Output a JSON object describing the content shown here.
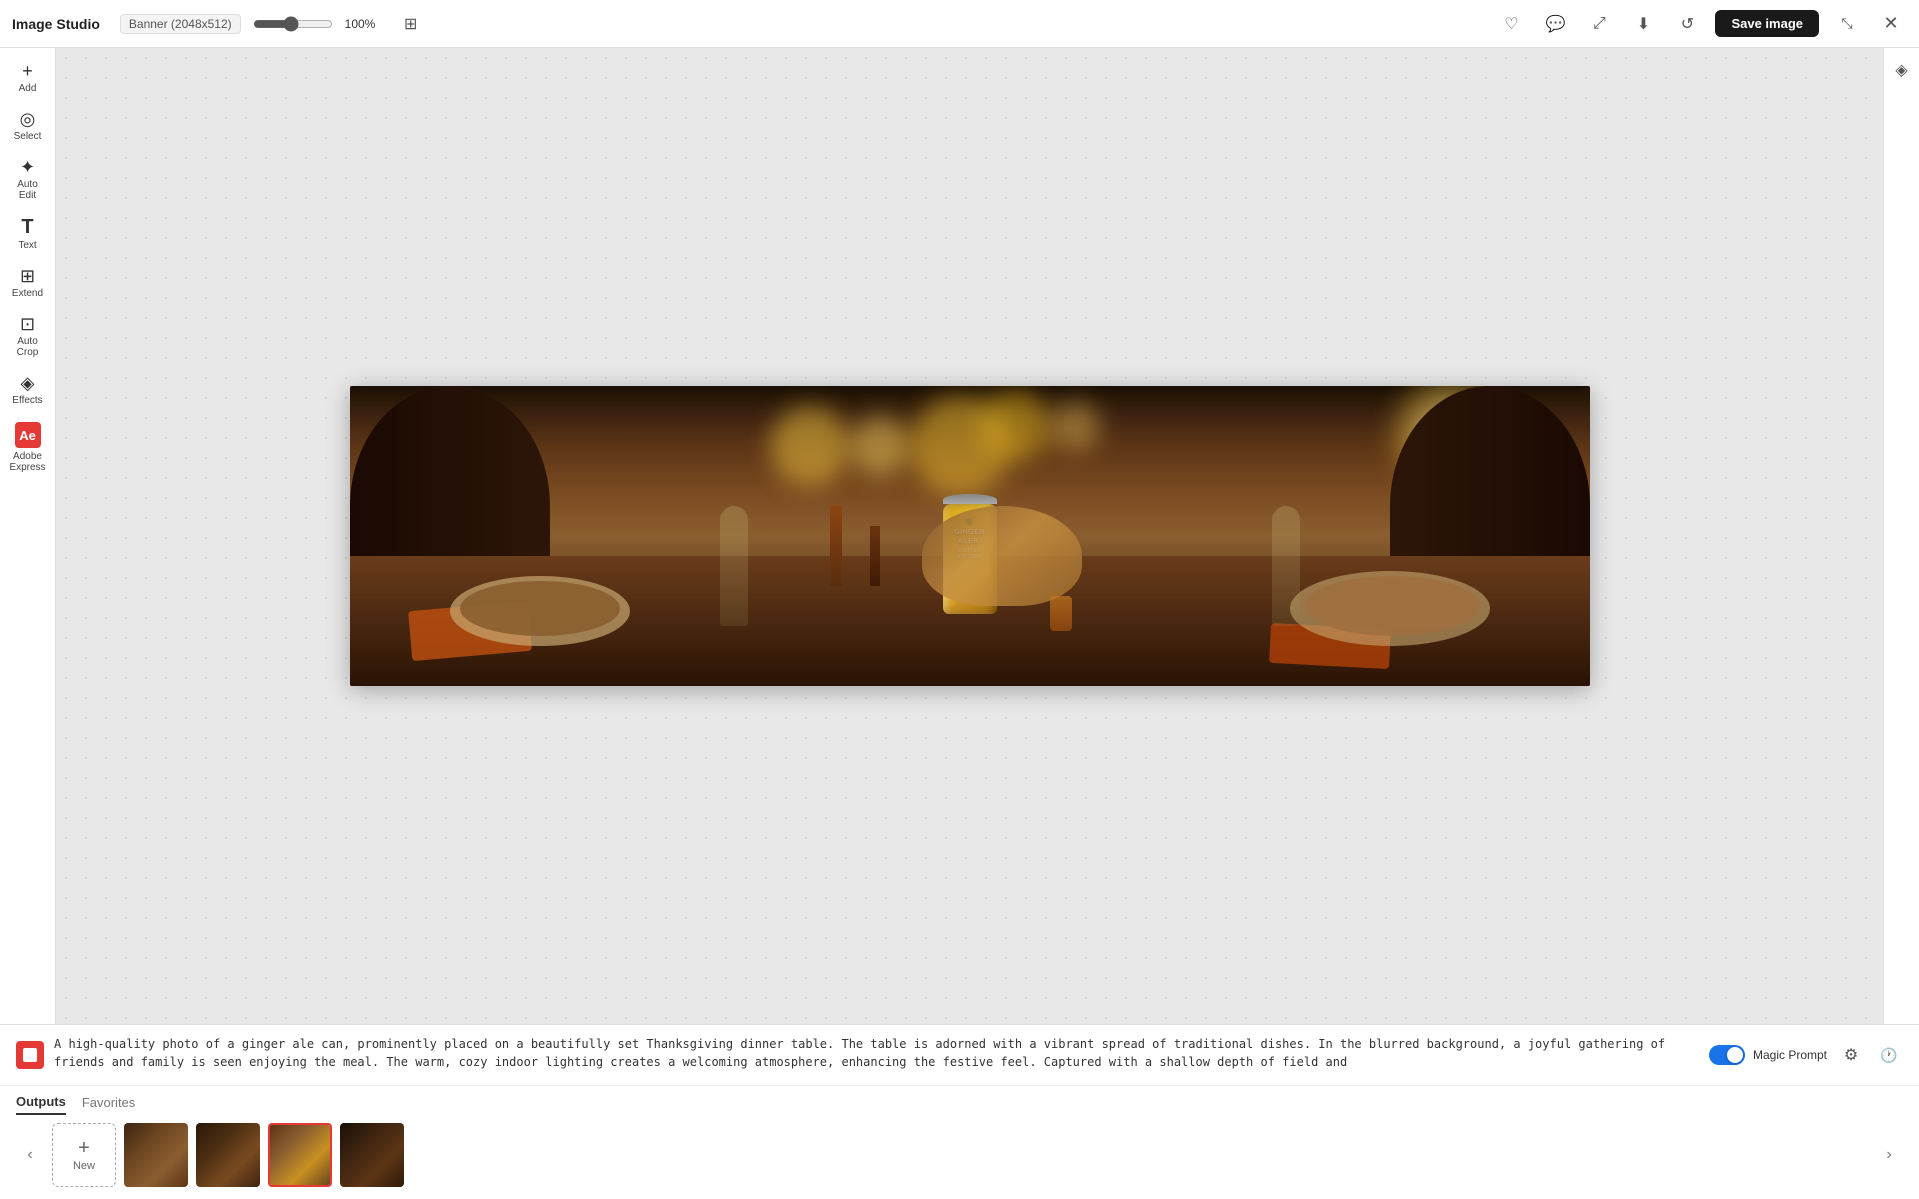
{
  "app": {
    "title": "Image Studio"
  },
  "topbar": {
    "canvas_size": "Banner (2048x512)",
    "zoom_value": 100,
    "zoom_label": "100%",
    "save_label": "Save image"
  },
  "sidebar": {
    "tools": [
      {
        "id": "add",
        "icon": "+",
        "label": "Add"
      },
      {
        "id": "select",
        "icon": "◎",
        "label": "Select"
      },
      {
        "id": "auto-edit",
        "icon": "✦",
        "label": "Auto Edit"
      },
      {
        "id": "text",
        "icon": "T",
        "label": "Text"
      },
      {
        "id": "extend",
        "icon": "⊞",
        "label": "Extend"
      },
      {
        "id": "auto-crop",
        "icon": "⊡",
        "label": "Auto Crop"
      },
      {
        "id": "effects",
        "icon": "◈",
        "label": "Effects"
      },
      {
        "id": "adobe-express",
        "icon": "Ae",
        "label": "Adobe Express"
      }
    ]
  },
  "prompt": {
    "text": "A high-quality photo of a ginger ale can, prominently placed on a beautifully set Thanksgiving dinner table. The table is adorned with a vibrant spread of traditional dishes. In the blurred background, a joyful gathering of friends and family is seen enjoying the meal. The warm, cozy indoor lighting creates a welcoming atmosphere, enhancing the festive feel. Captured with a shallow depth of field and",
    "magic_prompt_label": "Magic Prompt",
    "icon_label": "prompt-icon"
  },
  "outputs": {
    "outputs_tab": "Outputs",
    "favorites_tab": "Favorites"
  },
  "thumbnails": {
    "new_label": "New",
    "new_plus": "+",
    "items": [
      {
        "id": "thumb-1",
        "selected": false
      },
      {
        "id": "thumb-2",
        "selected": false
      },
      {
        "id": "thumb-3",
        "selected": true
      },
      {
        "id": "thumb-4",
        "selected": false
      }
    ]
  },
  "icons": {
    "heart": "♡",
    "comment": "💬",
    "share": "⤢",
    "download": "⬇",
    "refresh": "↺",
    "expand": "⤡",
    "close": "✕",
    "settings": "⚙",
    "history": "🕐",
    "chevron_left": "‹",
    "chevron_right": "›",
    "eraser": "◈"
  }
}
